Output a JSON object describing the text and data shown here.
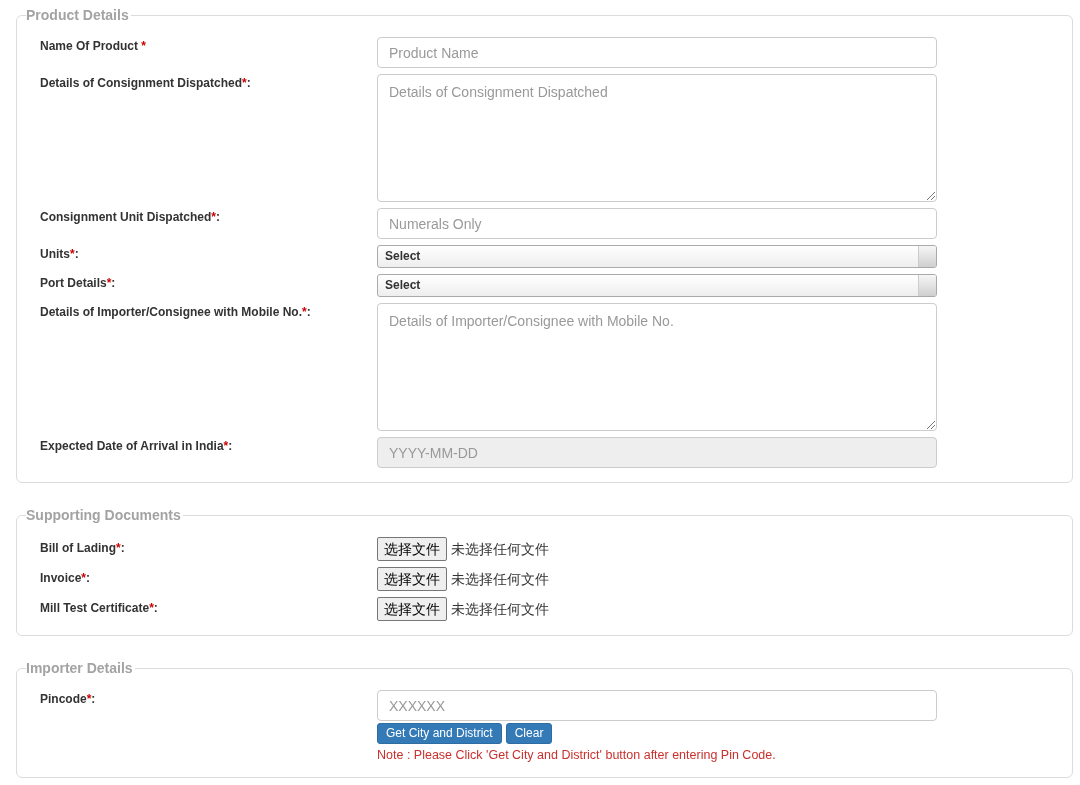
{
  "sections": [
    {
      "legend": "Product Details",
      "fields": [
        {
          "kind": "text",
          "label": "Name Of Product ",
          "required_mark": "*",
          "placeholder": "Product Name",
          "disabled": false
        },
        {
          "kind": "textarea",
          "label": "Details of Consignment Dispatched",
          "required_mark": "*",
          "colon": ":",
          "placeholder": "Details of Consignment Dispatched",
          "disabled": false
        },
        {
          "kind": "text",
          "label": "Consignment Unit Dispatched",
          "required_mark": "*",
          "colon": ":",
          "placeholder": "Numerals Only",
          "disabled": false
        },
        {
          "kind": "select",
          "label": "Units",
          "required_mark": "*",
          "colon": ":",
          "value": "Select",
          "disabled": false
        },
        {
          "kind": "select",
          "label": "Port Details",
          "required_mark": "*",
          "colon": ":",
          "value": "Select",
          "disabled": false
        },
        {
          "kind": "textarea",
          "label": "Details of Importer/Consignee with Mobile No.",
          "required_mark": "*",
          "colon": ":",
          "placeholder": "Details of Importer/Consignee with Mobile No.",
          "disabled": false
        },
        {
          "kind": "date",
          "label": "Expected Date of Arrival in India",
          "required_mark": "*",
          "colon": ":",
          "placeholder": "YYYY-MM-DD",
          "disabled": true
        }
      ]
    },
    {
      "legend": "Supporting Documents",
      "fields": [
        {
          "kind": "file",
          "label": "Bill of Lading",
          "required_mark": "*",
          "colon": ":",
          "button": "选择文件",
          "status": "未选择任何文件",
          "disabled": false
        },
        {
          "kind": "file",
          "label": "Invoice",
          "required_mark": "*",
          "colon": ":",
          "button": "选择文件",
          "status": "未选择任何文件",
          "disabled": false
        },
        {
          "kind": "file",
          "label": "Mill Test Certificate",
          "required_mark": "*",
          "colon": ":",
          "button": "选择文件",
          "status": "未选择任何文件",
          "disabled": false
        }
      ]
    },
    {
      "legend": "Importer Details",
      "fields": [
        {
          "kind": "text",
          "label": "Pincode",
          "required_mark": "*",
          "colon": ":",
          "placeholder": "XXXXXX",
          "disabled": false,
          "buttons": [
            "Get City and District",
            "Clear"
          ],
          "note": "Note : Please Click 'Get City and District' button after entering Pin Code."
        }
      ]
    }
  ]
}
